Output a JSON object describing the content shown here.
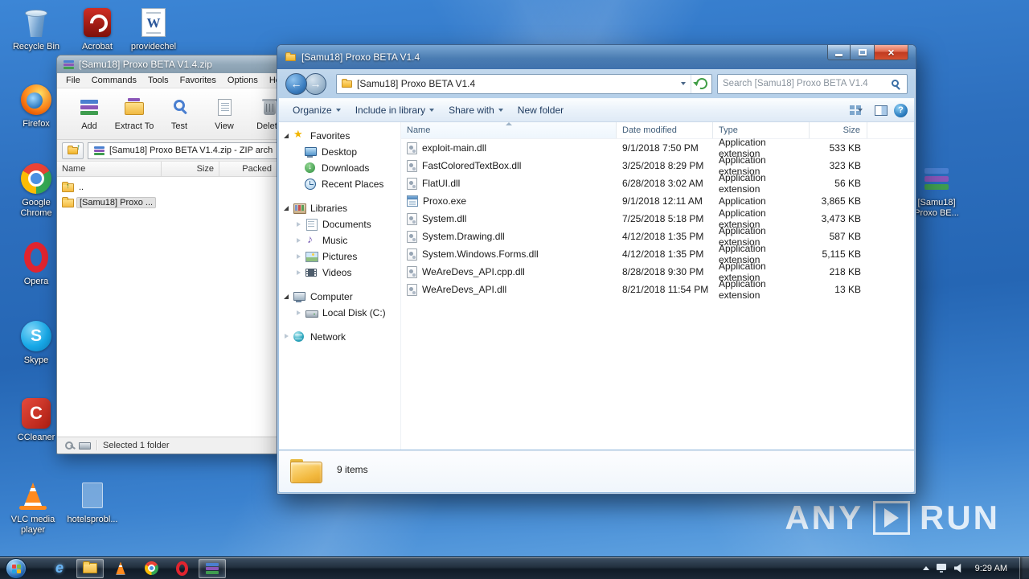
{
  "colors": {
    "titlebar_active": "#3f71ad",
    "desktop_blue": "#2d6fbe",
    "folder_yellow": "#f4bb3f",
    "selection_gray": "#e2e2e2"
  },
  "desktop": {
    "icons": [
      {
        "label": "Recycle Bin"
      },
      {
        "label": "Acrobat"
      },
      {
        "label": "providechel"
      },
      {
        "label": "Firefox"
      },
      {
        "label": "Google Chrome"
      },
      {
        "label": "Opera"
      },
      {
        "label": "Skype"
      },
      {
        "label": "CCleaner"
      },
      {
        "label": "VLC media player"
      },
      {
        "label": "hotelsprobl..."
      },
      {
        "label": "[Samu18] Proxo BE..."
      }
    ],
    "watermark": {
      "any": "ANY",
      "run": "RUN"
    }
  },
  "winrar": {
    "title": "[Samu18] Proxo BETA V1.4.zip",
    "menu": [
      "File",
      "Commands",
      "Tools",
      "Favorites",
      "Options",
      "Help"
    ],
    "toolbar": [
      "Add",
      "Extract To",
      "Test",
      "View",
      "Delete"
    ],
    "address": "[Samu18] Proxo BETA V1.4.zip - ZIP arch",
    "columns": {
      "name": "Name",
      "size": "Size",
      "packed": "Packed"
    },
    "rows": [
      {
        "name": ".."
      },
      {
        "name": "[Samu18] Proxo ..."
      }
    ],
    "status": "Selected 1 folder"
  },
  "explorer": {
    "title": "[Samu18] Proxo BETA V1.4",
    "address": "[Samu18] Proxo BETA V1.4",
    "search": "Search [Samu18] Proxo BETA V1.4",
    "commands": [
      "Organize",
      "Include in library",
      "Share with",
      "New folder"
    ],
    "columns": {
      "name": "Name",
      "date": "Date modified",
      "type": "Type",
      "size": "Size"
    },
    "sidebar": {
      "favorites": {
        "label": "Favorites",
        "items": [
          "Desktop",
          "Downloads",
          "Recent Places"
        ]
      },
      "libraries": {
        "label": "Libraries",
        "items": [
          "Documents",
          "Music",
          "Pictures",
          "Videos"
        ]
      },
      "computer": {
        "label": "Computer",
        "items": [
          "Local Disk (C:)"
        ]
      },
      "network": {
        "label": "Network"
      }
    },
    "files": [
      {
        "name": "exploit-main.dll",
        "date": "9/1/2018 7:50 PM",
        "type": "Application extension",
        "size": "533 KB"
      },
      {
        "name": "FastColoredTextBox.dll",
        "date": "3/25/2018 8:29 PM",
        "type": "Application extension",
        "size": "323 KB"
      },
      {
        "name": "FlatUI.dll",
        "date": "6/28/2018 3:02 AM",
        "type": "Application extension",
        "size": "56 KB"
      },
      {
        "name": "Proxo.exe",
        "date": "9/1/2018 12:11 AM",
        "type": "Application",
        "size": "3,865 KB"
      },
      {
        "name": "System.dll",
        "date": "7/25/2018 5:18 PM",
        "type": "Application extension",
        "size": "3,473 KB"
      },
      {
        "name": "System.Drawing.dll",
        "date": "4/12/2018 1:35 PM",
        "type": "Application extension",
        "size": "587 KB"
      },
      {
        "name": "System.Windows.Forms.dll",
        "date": "4/12/2018 1:35 PM",
        "type": "Application extension",
        "size": "5,115 KB"
      },
      {
        "name": "WeAreDevs_API.cpp.dll",
        "date": "8/28/2018 9:30 PM",
        "type": "Application extension",
        "size": "218 KB"
      },
      {
        "name": "WeAreDevs_API.dll",
        "date": "8/21/2018 11:54 PM",
        "type": "Application extension",
        "size": "13 KB"
      }
    ],
    "status": "9 items"
  },
  "taskbar": {
    "buttons": [
      "internet-explorer",
      "windows-explorer",
      "vlc",
      "chrome",
      "opera",
      "winrar"
    ],
    "time": "9:29 AM"
  }
}
